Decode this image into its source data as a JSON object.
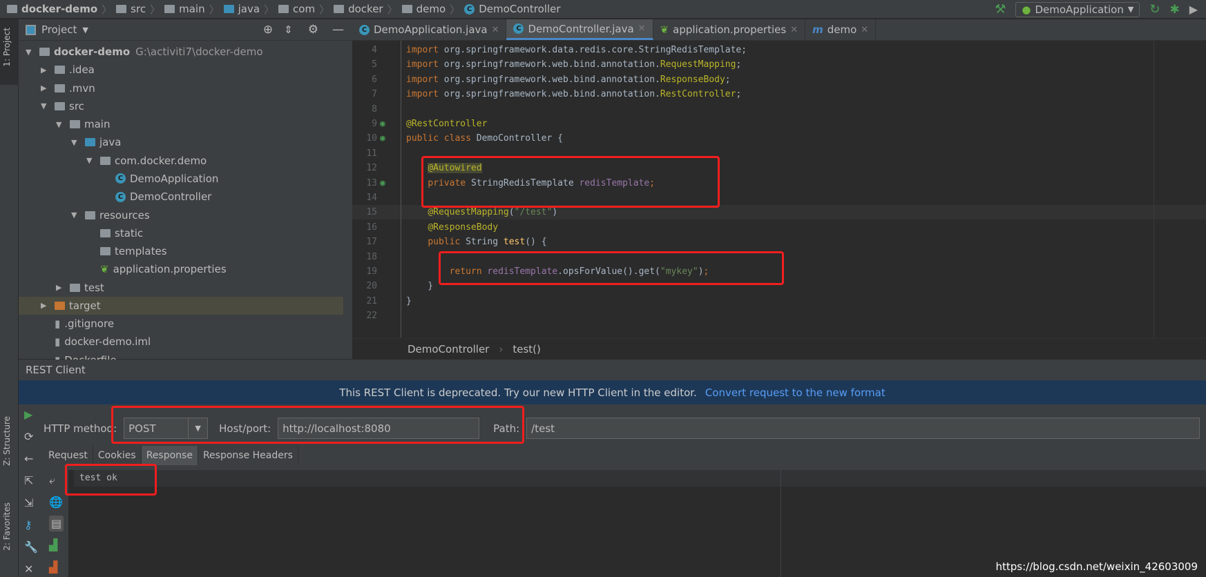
{
  "breadcrumb": [
    "docker-demo",
    "src",
    "main",
    "java",
    "com",
    "docker",
    "demo",
    "DemoController"
  ],
  "run_config": "DemoApplication",
  "left_strip": {
    "project": "1: Project",
    "structure": "Z: Structure",
    "favorites": "2: Favorites"
  },
  "project_panel": {
    "title": "Project",
    "tree": [
      {
        "label": "docker-demo",
        "extra": "G:\\activiti7\\docker-demo",
        "level": 0,
        "open": true,
        "icon": "module-folder"
      },
      {
        "label": ".idea",
        "level": 1,
        "open": false,
        "icon": "folder"
      },
      {
        "label": ".mvn",
        "level": 1,
        "open": false,
        "icon": "folder"
      },
      {
        "label": "src",
        "level": 1,
        "open": true,
        "icon": "folder"
      },
      {
        "label": "main",
        "level": 2,
        "open": true,
        "icon": "folder"
      },
      {
        "label": "java",
        "level": 3,
        "open": true,
        "icon": "source-folder"
      },
      {
        "label": "com.docker.demo",
        "level": 4,
        "open": true,
        "icon": "package"
      },
      {
        "label": "DemoApplication",
        "level": 5,
        "icon": "spring-class"
      },
      {
        "label": "DemoController",
        "level": 5,
        "icon": "class"
      },
      {
        "label": "resources",
        "level": 3,
        "open": true,
        "icon": "resources-folder"
      },
      {
        "label": "static",
        "level": 4,
        "icon": "folder"
      },
      {
        "label": "templates",
        "level": 4,
        "icon": "folder"
      },
      {
        "label": "application.properties",
        "level": 4,
        "icon": "spring-properties"
      },
      {
        "label": "test",
        "level": 2,
        "open": false,
        "icon": "folder"
      },
      {
        "label": "target",
        "level": 1,
        "open": false,
        "icon": "excluded-folder",
        "selected": true
      },
      {
        "label": ".gitignore",
        "level": 1,
        "icon": "file"
      },
      {
        "label": "docker-demo.iml",
        "level": 1,
        "icon": "file"
      },
      {
        "label": "Dockerfile",
        "level": 1,
        "icon": "file"
      }
    ]
  },
  "editor_tabs": [
    {
      "label": "DemoApplication.java",
      "active": false
    },
    {
      "label": "DemoController.java",
      "active": true
    },
    {
      "label": "application.properties",
      "active": false
    },
    {
      "label": "demo",
      "active": false
    }
  ],
  "code": [
    {
      "n": "4",
      "t": [
        [
          "kw",
          "import "
        ],
        [
          "pl",
          "org.springframework.data.redis.core.StringRedisTemplate;"
        ]
      ]
    },
    {
      "n": "5",
      "t": [
        [
          "kw",
          "import "
        ],
        [
          "pl",
          "org.springframework.web.bind.annotation."
        ],
        [
          "ann",
          "RequestMapping"
        ],
        [
          "pl",
          ";"
        ]
      ]
    },
    {
      "n": "6",
      "t": [
        [
          "kw",
          "import "
        ],
        [
          "pl",
          "org.springframework.web.bind.annotation."
        ],
        [
          "ann",
          "ResponseBody"
        ],
        [
          "pl",
          ";"
        ]
      ]
    },
    {
      "n": "7",
      "t": [
        [
          "kw",
          "import "
        ],
        [
          "pl",
          "org.springframework.web.bind.annotation."
        ],
        [
          "ann",
          "RestController"
        ],
        [
          "pl",
          ";"
        ]
      ]
    },
    {
      "n": "8",
      "t": []
    },
    {
      "n": "9",
      "t": [
        [
          "ann",
          "@RestController"
        ]
      ]
    },
    {
      "n": "10",
      "t": [
        [
          "kw",
          "public class "
        ],
        [
          "cls",
          "DemoController "
        ],
        [
          "pl",
          "{"
        ]
      ]
    },
    {
      "n": "11",
      "t": []
    },
    {
      "n": "12",
      "t": [
        [
          "pl",
          "    "
        ],
        [
          "ann annhl",
          "@Autowired"
        ]
      ]
    },
    {
      "n": "13",
      "t": [
        [
          "pl",
          "    "
        ],
        [
          "kw",
          "private "
        ],
        [
          "cls",
          "StringRedisTemplate "
        ],
        [
          "fld",
          "redisTemplate"
        ],
        [
          "kw",
          ";"
        ]
      ]
    },
    {
      "n": "14",
      "t": []
    },
    {
      "n": "15",
      "t": [
        [
          "pl",
          "    "
        ],
        [
          "ann",
          "@RequestMapping"
        ],
        [
          "pl",
          "("
        ],
        [
          "str",
          "\"/test\""
        ],
        [
          "pl",
          ")"
        ]
      ]
    },
    {
      "n": "16",
      "t": [
        [
          "pl",
          "    "
        ],
        [
          "ann",
          "@ResponseBody"
        ]
      ]
    },
    {
      "n": "17",
      "t": [
        [
          "pl",
          "    "
        ],
        [
          "kw",
          "public "
        ],
        [
          "cls",
          "String "
        ],
        [
          "fn",
          "test"
        ],
        [
          "pl",
          "() {"
        ]
      ]
    },
    {
      "n": "18",
      "t": []
    },
    {
      "n": "19",
      "t": [
        [
          "pl",
          "        "
        ],
        [
          "kw",
          "return "
        ],
        [
          "fld",
          "redisTemplate"
        ],
        [
          "pl",
          ".opsForValue().get("
        ],
        [
          "str",
          "\"mykey\""
        ],
        [
          "pl",
          ")"
        ],
        [
          "kw",
          ";"
        ]
      ]
    },
    {
      "n": "20",
      "t": [
        [
          "pl",
          "    }"
        ]
      ]
    },
    {
      "n": "21",
      "t": [
        [
          "pl",
          "}"
        ]
      ]
    },
    {
      "n": "22",
      "t": []
    }
  ],
  "editor_breadcrumb": [
    "DemoController",
    "test()"
  ],
  "rest_client": {
    "title": "REST Client",
    "banner_text": "This REST Client is deprecated. Try our new HTTP Client in the editor.",
    "banner_link": "Convert request to the new format",
    "method_label": "HTTP method:",
    "method_value": "POST",
    "host_label": "Host/port:",
    "host_value": "http://localhost:8080",
    "path_label": "Path:",
    "path_value": "/test",
    "tabs": [
      "Request",
      "Cookies",
      "Response",
      "Response Headers"
    ],
    "active_tab": "Response",
    "response_text": "test ok"
  },
  "watermark": "https://blog.csdn.net/weixin_42603009",
  "colors": {
    "highlight_box": "#f21e1e",
    "banner": "#1d3857",
    "link": "#589df6"
  }
}
